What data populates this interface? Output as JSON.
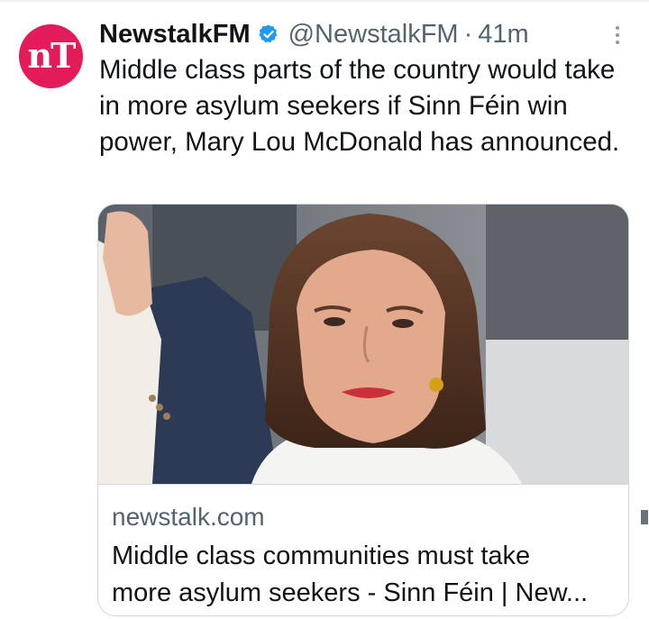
{
  "tweet": {
    "avatar_text": "nT",
    "display_name": "NewstalkFM",
    "handle": "@NewstalkFM",
    "separator": "·",
    "timestamp": "41m",
    "text": "Middle class parts of the country would take in more asylum seekers if Sinn Féin win power, Mary Lou McDonald has announced."
  },
  "card": {
    "domain": "newstalk.com",
    "title_line1": "Middle class communities must take",
    "title_line2": "more asylum seekers - Sinn Féin | New..."
  },
  "icons": {
    "verified": "verified-badge-icon",
    "more": "more-options-icon"
  },
  "colors": {
    "avatar_bg": "#e31b58",
    "verified_blue": "#1d9bf0",
    "secondary_text": "#536471",
    "card_border": "#cfd9de"
  }
}
